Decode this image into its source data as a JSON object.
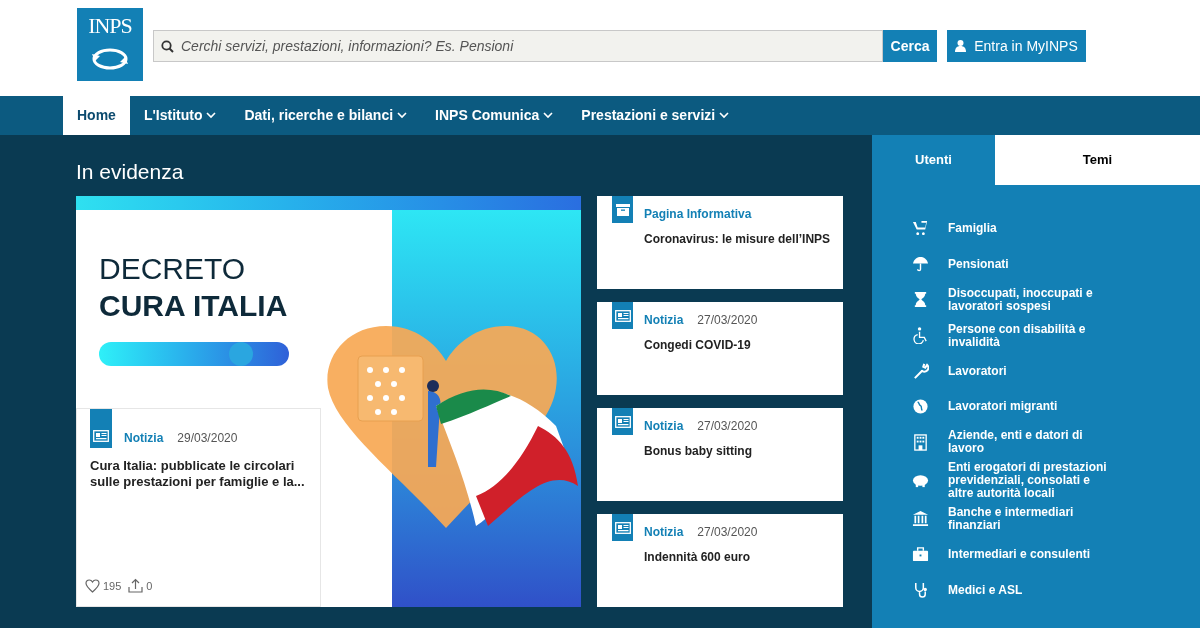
{
  "header": {
    "logo": "INPS",
    "search": {
      "placeholder": "Cerchi servizi, prestazioni, informazioni? Es. Pensioni"
    },
    "search_button": "Cerca",
    "login_button": "Entra in MyINPS"
  },
  "nav": [
    {
      "label": "Home",
      "selected": true,
      "dropdown": false
    },
    {
      "label": "L'Istituto",
      "selected": false,
      "dropdown": true
    },
    {
      "label": "Dati, ricerche e bilanci",
      "selected": false,
      "dropdown": true
    },
    {
      "label": "INPS Comunica",
      "selected": false,
      "dropdown": true
    },
    {
      "label": "Prestazioni e servizi",
      "selected": false,
      "dropdown": true
    }
  ],
  "section_title": "In evidenza",
  "hero": {
    "banner_lines": [
      "DECRETO",
      "CURA ITALIA"
    ],
    "kind": "news",
    "category": "Notizia",
    "date": "29/03/2020",
    "title": "Cura Italia: pubblicate le circolari sulle prestazioni per famiglie e la...",
    "likes": "195",
    "shares": "0"
  },
  "cards": [
    {
      "kind": "page",
      "category": "Pagina Informativa",
      "title": "Coronavirus: le misure dell’INPS"
    },
    {
      "kind": "news",
      "category": "Notizia",
      "date": "27/03/2020",
      "title": "Congedi COVID-19"
    },
    {
      "kind": "news",
      "category": "Notizia",
      "date": "27/03/2020",
      "title": "Bonus baby sitting"
    },
    {
      "kind": "news",
      "category": "Notizia",
      "date": "27/03/2020",
      "title": "Indennità 600 euro"
    }
  ],
  "sidebar": {
    "tabs": [
      {
        "label": "Utenti",
        "selected": true
      },
      {
        "label": "Temi",
        "selected": false
      }
    ],
    "items": [
      "Famiglia",
      "Pensionati",
      "Disoccupati, inoccupati e lavoratori sospesi",
      "Persone con disabilità e invalidità",
      "Lavoratori",
      "Lavoratori migranti",
      "Aziende, enti e datori di lavoro",
      "Enti erogatori di prestazioni previdenziali, consolati e altre autorità locali",
      "Banche e intermediari finanziari",
      "Intermediari e consulenti",
      "Medici e ASL"
    ]
  }
}
